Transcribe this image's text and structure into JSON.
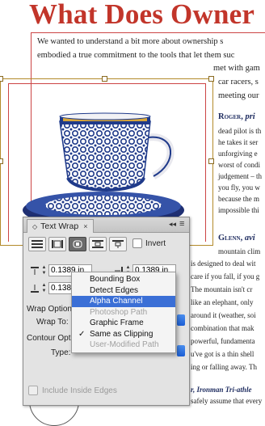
{
  "document": {
    "headline": "What Does Owner",
    "para1": [
      "We wanted to understand a bit more about ownership s",
      "embodied a true commitment to the tools that let them suc"
    ],
    "wrap_lines_right": [
      "met with gam",
      "car racers, s",
      "meeting our"
    ],
    "roger_heading": "Roger,",
    "roger_role": "pri",
    "roger_lines": [
      "dead pilot is th",
      "he takes it ser",
      "unforgiving e",
      "worst of condi",
      "judgement – th",
      "you fly, you w",
      "because the m",
      "impossible thi"
    ],
    "glenn_heading": "Glenn,",
    "glenn_role": "avi",
    "glenn_lines": [
      "mountain clim",
      "is designed to deal wit",
      "care if you fall, if you g",
      "The mountain isn't cr",
      "like an elephant, only",
      "around it (weather, soi",
      "combination that mak",
      "powerful, fundamenta",
      "u've got is a thin shell",
      "ing or falling away. Th"
    ],
    "bottom_role": "r, Ironman Tri-athle",
    "bottom_line": "safely assume that every"
  },
  "panel": {
    "title": "Text Wrap",
    "close_glyph": "×",
    "menu_glyph": "≡",
    "collapse_glyph": "◂◂",
    "invert_label": "Invert",
    "offsets": {
      "top": "0.1389 in",
      "bottom": "0.1389 in",
      "left": "0.1389 in",
      "right": "0.1389 in"
    },
    "wrap_options_label": "Wrap Options",
    "wrap_to_label": "Wrap To:",
    "contour_options_label": "Contour Opti",
    "type_label": "Type:",
    "include_inside_edges": "Include Inside Edges"
  },
  "menu": {
    "items": [
      {
        "label": "Bounding Box",
        "state": "normal"
      },
      {
        "label": "Detect Edges",
        "state": "normal"
      },
      {
        "label": "Alpha Channel",
        "state": "highlighted"
      },
      {
        "label": "Photoshop Path",
        "state": "disabled"
      },
      {
        "label": "Graphic Frame",
        "state": "normal"
      },
      {
        "label": "Same as Clipping",
        "state": "checked"
      },
      {
        "label": "User-Modified Path",
        "state": "disabled"
      }
    ],
    "check_glyph": "✓"
  },
  "colors": {
    "headline": "#c2352a",
    "highlight": "#3b6fd6",
    "cup_blue": "#1f3a8a"
  }
}
